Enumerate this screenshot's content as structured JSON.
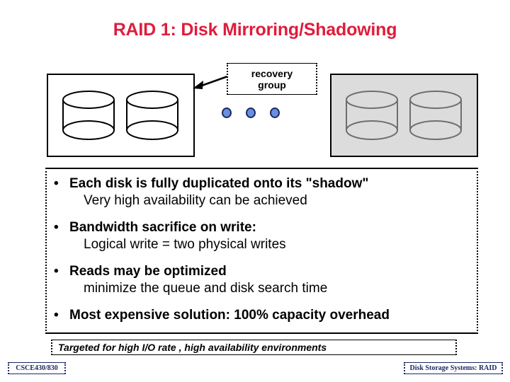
{
  "slide": {
    "title": "RAID 1: Disk Mirroring/Shadowing",
    "title_color": "#e01c3c"
  },
  "diagram": {
    "primary_group": {
      "name": "primary-disk-group",
      "fill_color": "#ffffff",
      "border_color": "#000000",
      "disk_count": 2,
      "disk_outline_color": "#000000",
      "disk_fill_color": "#ffffff"
    },
    "shadow_group": {
      "name": "shadow-disk-group",
      "fill_color": "#dcdcdc",
      "border_color": "#000000",
      "disk_count": 2,
      "disk_outline_color": "#6e6e6e",
      "disk_fill_color": "#dcdcdc"
    },
    "callout": {
      "label": "recovery\ngroup",
      "label_line1": "recovery",
      "label_line2": "group",
      "arrow_direction": "left"
    },
    "ellipsis_dots": {
      "count": 3,
      "fill_color": "#6a8fdf",
      "ring_color": "#1b2a63"
    }
  },
  "body": {
    "bullets": [
      {
        "marker": "•",
        "line1": "Each disk is fully duplicated onto its \"shadow\"",
        "line2": "Very high availability can be achieved"
      },
      {
        "marker": "•",
        "line1": "Bandwidth sacrifice on write:",
        "line2": "Logical write = two physical writes"
      },
      {
        "marker": "•",
        "line1": "Reads may be optimized",
        "line2": "minimize the queue and disk search time"
      },
      {
        "marker": "•",
        "line1": "Most expensive solution: 100% capacity overhead",
        "line2": ""
      }
    ]
  },
  "tagline": {
    "text": "Targeted for high I/O rate , high availability environments"
  },
  "footer": {
    "left": "CSCE430/830",
    "right": "Disk Storage Systems: RAID",
    "color": "#1b2a63"
  }
}
